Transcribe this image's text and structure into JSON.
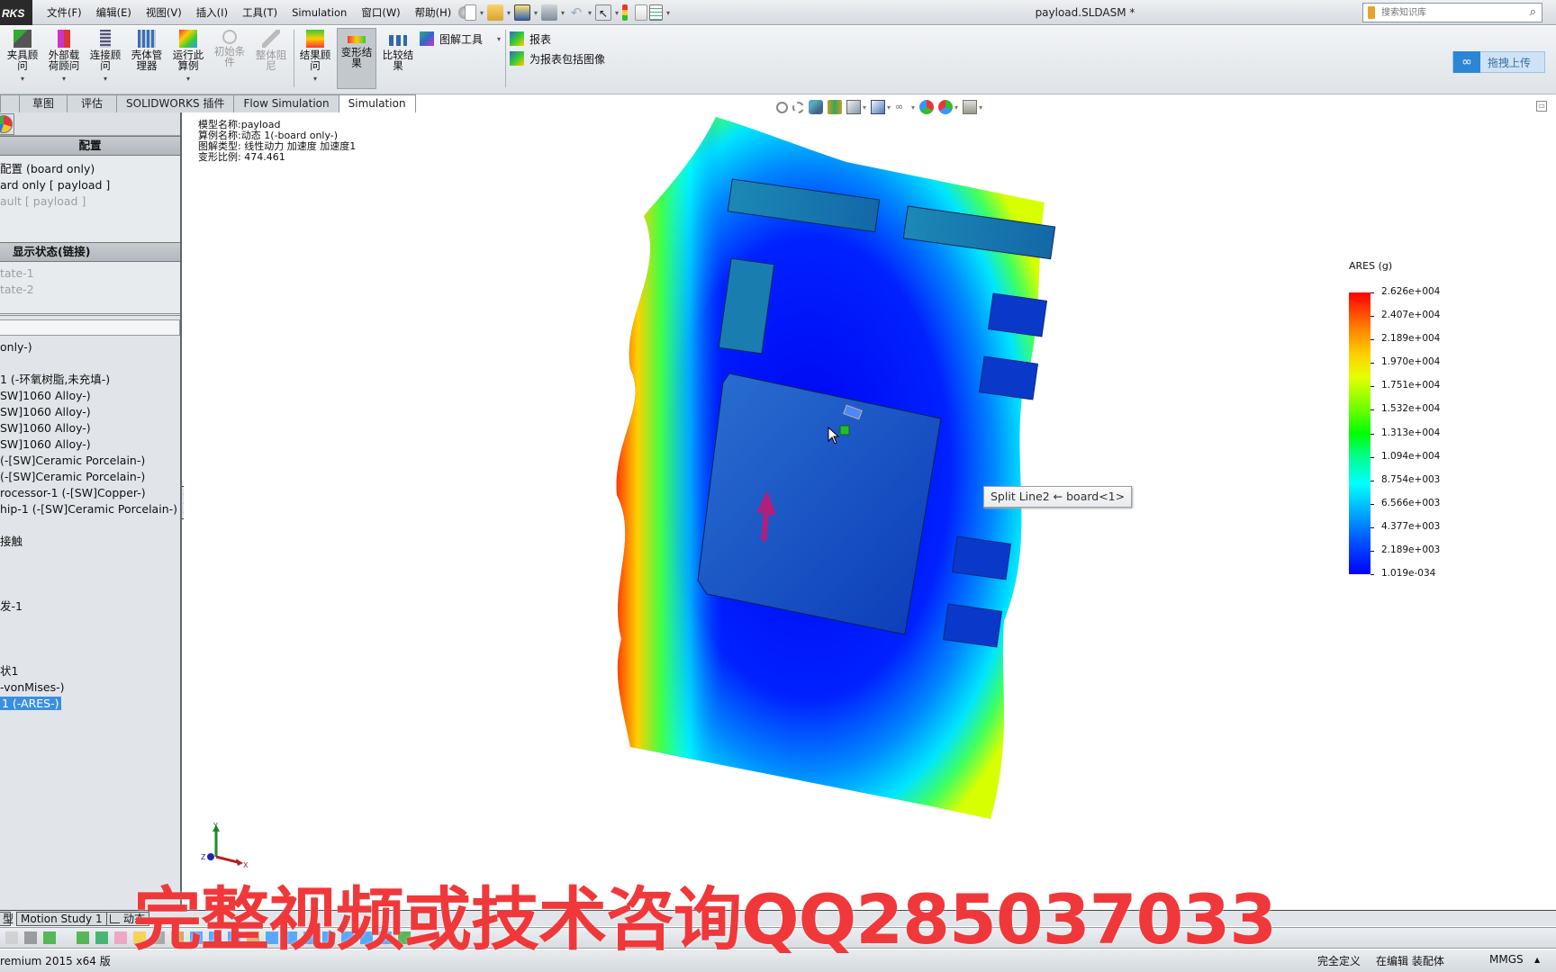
{
  "app": {
    "logo_text": "RKS",
    "document_title": "payload.SLDASM *",
    "menu": [
      "文件(F)",
      "编辑(E)",
      "视图(V)",
      "插入(I)",
      "工具(T)",
      "Simulation",
      "窗口(W)",
      "帮助(H)"
    ],
    "search_placeholder": "搜索知识库",
    "upload_button": "拖拽上传"
  },
  "ribbon": {
    "buttons": [
      {
        "label": "夹具顾问",
        "dropdown": true,
        "enabled": true
      },
      {
        "label": "外部载荷顾问",
        "dropdown": true,
        "enabled": true
      },
      {
        "label": "连接顾问",
        "dropdown": true,
        "enabled": true
      },
      {
        "label": "壳体管理器",
        "dropdown": false,
        "enabled": true
      },
      {
        "label": "运行此算例",
        "dropdown": true,
        "enabled": true
      },
      {
        "label": "初始条件",
        "dropdown": false,
        "enabled": false
      },
      {
        "label": "整体阻尼",
        "dropdown": false,
        "enabled": false
      },
      {
        "label": "结果顾问",
        "dropdown": true,
        "enabled": true
      },
      {
        "label": "变形结果",
        "dropdown": false,
        "enabled": true,
        "active": true
      },
      {
        "label": "比较结果",
        "dropdown": false,
        "enabled": true
      }
    ],
    "plot_tools": "图解工具",
    "report": "报表",
    "include_image": "为报表包括图像"
  },
  "tabs": [
    {
      "label": "草图",
      "active": false
    },
    {
      "label": "评估",
      "active": false
    },
    {
      "label": "SOLIDWORKS 插件",
      "active": false
    },
    {
      "label": "Flow Simulation",
      "active": false
    },
    {
      "label": "Simulation",
      "active": true
    }
  ],
  "left_panel": {
    "config_header": "配置",
    "config_items": [
      {
        "text": "配置  (board only)",
        "dim": false
      },
      {
        "text": "ard only [ payload ]",
        "dim": false
      },
      {
        "text": "ault [ payload ]",
        "dim": true
      }
    ],
    "display_state_header": "显示状态(链接)",
    "display_states": [
      "tate-1",
      "tate-2"
    ],
    "tree": [
      {
        "text": " only-)"
      },
      {
        "text": ""
      },
      {
        "text": "1 (-环氧树脂,未充填-)"
      },
      {
        "text": "SW]1060 Alloy-)"
      },
      {
        "text": "SW]1060 Alloy-)"
      },
      {
        "text": "SW]1060 Alloy-)"
      },
      {
        "text": "SW]1060 Alloy-)"
      },
      {
        "text": "(-[SW]Ceramic Porcelain-)"
      },
      {
        "text": "(-[SW]Ceramic Porcelain-)"
      },
      {
        "text": "rocessor-1 (-[SW]Copper-)"
      },
      {
        "text": "hip-1 (-[SW]Ceramic Porcelain-)"
      },
      {
        "text": ""
      },
      {
        "text": "接触"
      },
      {
        "text": ""
      },
      {
        "text": ""
      },
      {
        "text": ""
      },
      {
        "text": "发-1"
      },
      {
        "text": ""
      },
      {
        "text": ""
      },
      {
        "text": ""
      },
      {
        "text": "状1"
      },
      {
        "text": "-vonMises-)"
      },
      {
        "text": "1 (-ARES-)",
        "selected": true
      }
    ]
  },
  "viewport": {
    "info": [
      "模型名称:payload",
      "算例名称:动态 1(-board only-)",
      "图解类型: 线性动力 加速度 加速度1",
      "变形比例: 474.461"
    ],
    "tooltip": "Split Line2 ← board<1>",
    "triad": {
      "x": "X",
      "y": "Y",
      "z": "Z"
    },
    "legend": {
      "title": "ARES (g)",
      "labels": [
        "2.626e+004",
        "2.407e+004",
        "2.189e+004",
        "1.970e+004",
        "1.751e+004",
        "1.532e+004",
        "1.313e+004",
        "1.094e+004",
        "8.754e+003",
        "6.566e+003",
        "4.377e+003",
        "2.189e+003",
        "1.019e-034"
      ],
      "max_color": "#ff0000",
      "min_color": "#0000ff"
    }
  },
  "bottom": {
    "tabs": [
      "型",
      "Motion Study 1",
      "动态"
    ],
    "status_left": "remium 2015 x64 版",
    "status_fully_defined": "完全定义",
    "status_editing": "在编辑 装配体",
    "units": "MMGS",
    "units_arrow": "▲"
  },
  "watermark": "完整视频或技术咨询QQ285037033"
}
